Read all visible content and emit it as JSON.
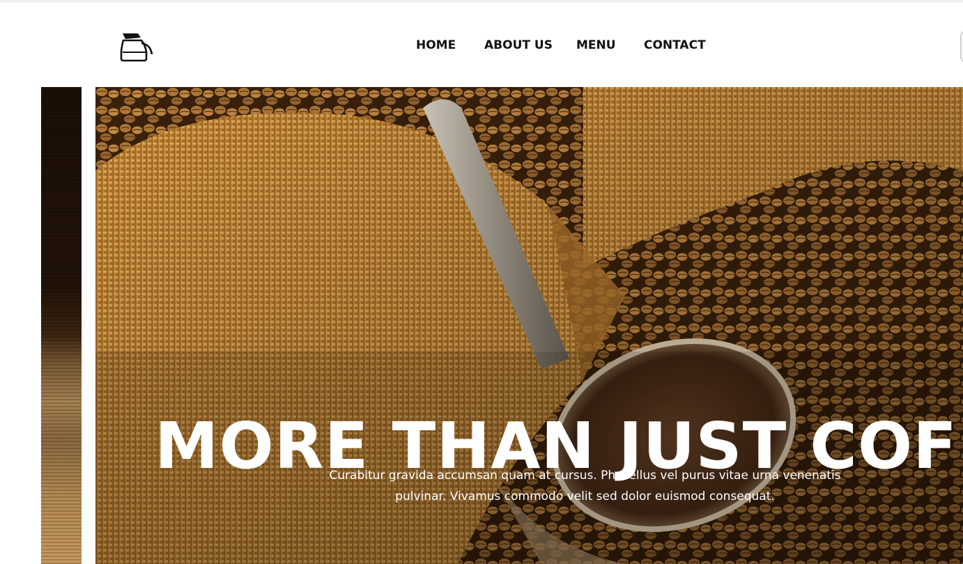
{
  "nav": {
    "items": [
      {
        "label": "HOME"
      },
      {
        "label": "ABOUT US"
      },
      {
        "label": "MENU"
      },
      {
        "label": "CONTACT"
      }
    ]
  },
  "logo": {
    "icon": "coffee-pot-icon"
  },
  "hero": {
    "title": "MORE THAN JUST COFFEE",
    "subtitle": "Curabitur gravida accumsan quam at cursus. Phasellus vel purus vitae urna venenatis pulvinar. Vivamus commodo velit sed dolor euismod consequat."
  },
  "colors": {
    "nav_text": "#111111",
    "hero_text": "#ffffff",
    "burlap": "#c8913f",
    "beans": "#8a5a2c"
  }
}
